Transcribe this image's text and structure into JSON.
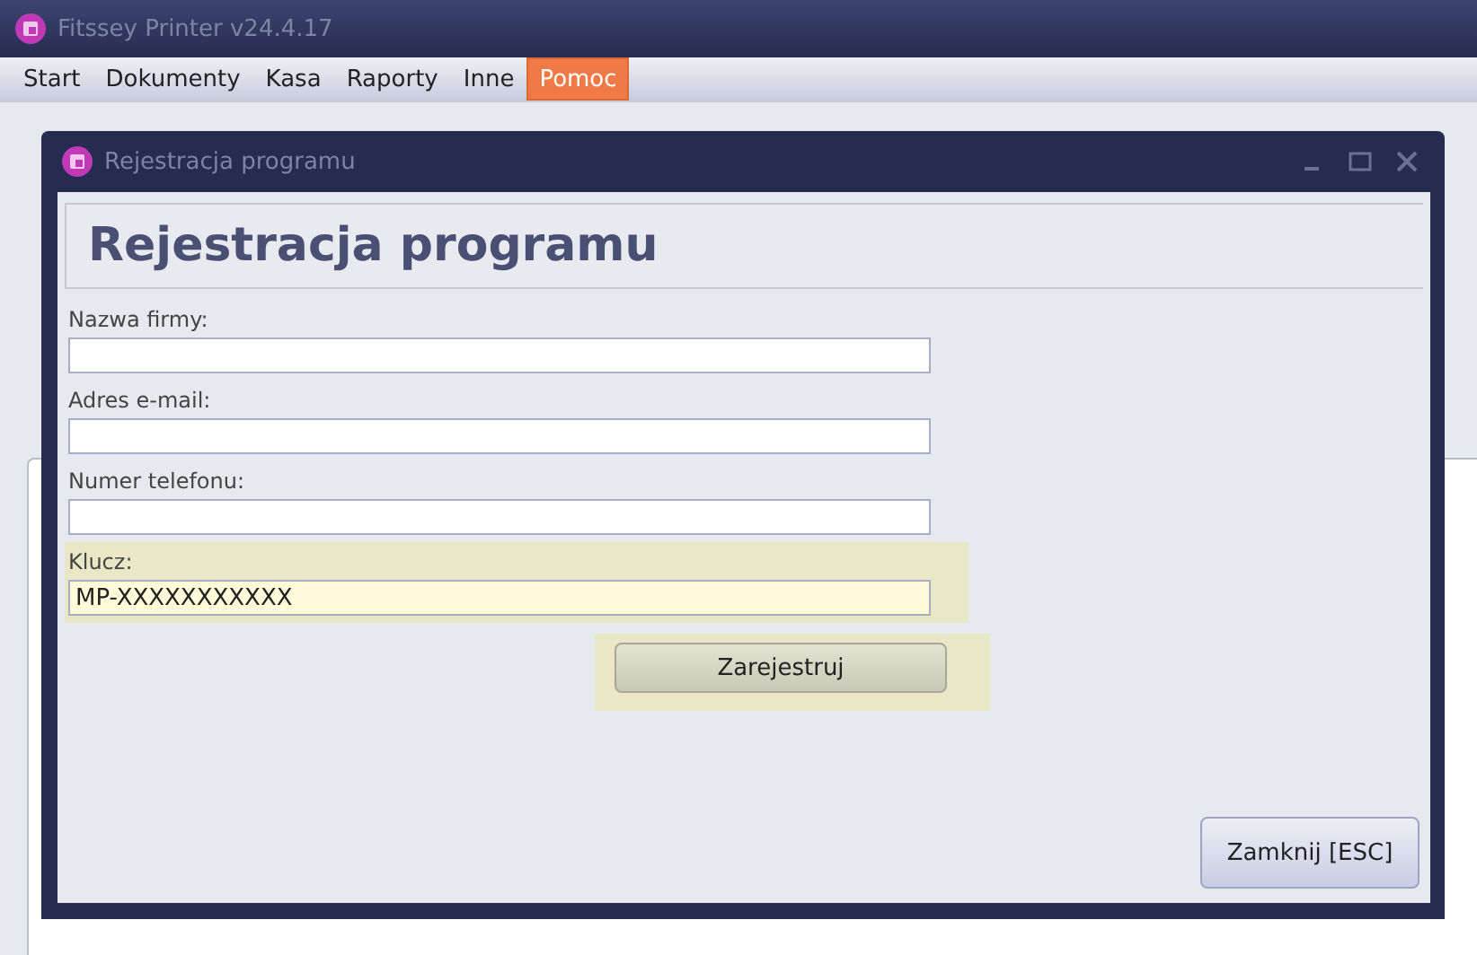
{
  "window": {
    "title": "Fitssey Printer v24.4.17"
  },
  "menu": [
    {
      "label": "Start",
      "selected": false
    },
    {
      "label": "Dokumenty",
      "selected": false
    },
    {
      "label": "Kasa",
      "selected": false
    },
    {
      "label": "Raporty",
      "selected": false
    },
    {
      "label": "Inne",
      "selected": false
    },
    {
      "label": "Pomoc",
      "selected": true
    }
  ],
  "dialog": {
    "title": "Rejestracja programu",
    "heading": "Rejestracja programu",
    "fields": [
      {
        "label": "Nazwa firmy:",
        "highlighted": false
      },
      {
        "label": "Adres e-mail:",
        "highlighted": false
      },
      {
        "label": "Numer telefonu:",
        "highlighted": false
      },
      {
        "label": "Klucz:",
        "value": "MP-XXXXXXXXXXX",
        "highlighted": true
      }
    ],
    "register_button": {
      "label": "Zarejestruj",
      "highlighted": true
    },
    "close_button": {
      "label": "Zamknij [ESC]"
    }
  }
}
